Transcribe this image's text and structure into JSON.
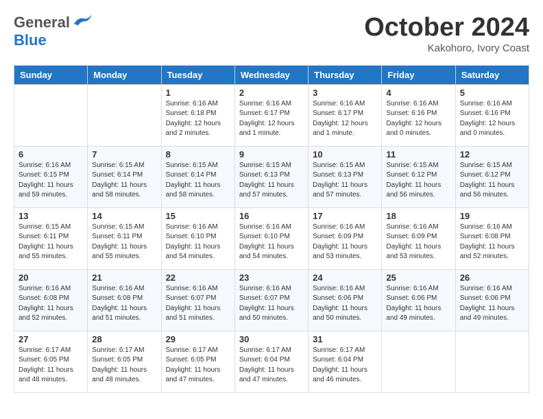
{
  "logo": {
    "general": "General",
    "blue": "Blue"
  },
  "title": "October 2024",
  "subtitle": "Kakohoro, Ivory Coast",
  "days_header": [
    "Sunday",
    "Monday",
    "Tuesday",
    "Wednesday",
    "Thursday",
    "Friday",
    "Saturday"
  ],
  "weeks": [
    [
      {
        "day": "",
        "info": ""
      },
      {
        "day": "",
        "info": ""
      },
      {
        "day": "1",
        "info": "Sunrise: 6:16 AM\nSunset: 6:18 PM\nDaylight: 12 hours\nand 2 minutes."
      },
      {
        "day": "2",
        "info": "Sunrise: 6:16 AM\nSunset: 6:17 PM\nDaylight: 12 hours\nand 1 minute."
      },
      {
        "day": "3",
        "info": "Sunrise: 6:16 AM\nSunset: 6:17 PM\nDaylight: 12 hours\nand 1 minute."
      },
      {
        "day": "4",
        "info": "Sunrise: 6:16 AM\nSunset: 6:16 PM\nDaylight: 12 hours\nand 0 minutes."
      },
      {
        "day": "5",
        "info": "Sunrise: 6:16 AM\nSunset: 6:16 PM\nDaylight: 12 hours\nand 0 minutes."
      }
    ],
    [
      {
        "day": "6",
        "info": "Sunrise: 6:16 AM\nSunset: 6:15 PM\nDaylight: 11 hours\nand 59 minutes."
      },
      {
        "day": "7",
        "info": "Sunrise: 6:15 AM\nSunset: 6:14 PM\nDaylight: 11 hours\nand 58 minutes."
      },
      {
        "day": "8",
        "info": "Sunrise: 6:15 AM\nSunset: 6:14 PM\nDaylight: 11 hours\nand 58 minutes."
      },
      {
        "day": "9",
        "info": "Sunrise: 6:15 AM\nSunset: 6:13 PM\nDaylight: 11 hours\nand 57 minutes."
      },
      {
        "day": "10",
        "info": "Sunrise: 6:15 AM\nSunset: 6:13 PM\nDaylight: 11 hours\nand 57 minutes."
      },
      {
        "day": "11",
        "info": "Sunrise: 6:15 AM\nSunset: 6:12 PM\nDaylight: 11 hours\nand 56 minutes."
      },
      {
        "day": "12",
        "info": "Sunrise: 6:15 AM\nSunset: 6:12 PM\nDaylight: 11 hours\nand 56 minutes."
      }
    ],
    [
      {
        "day": "13",
        "info": "Sunrise: 6:15 AM\nSunset: 6:11 PM\nDaylight: 11 hours\nand 55 minutes."
      },
      {
        "day": "14",
        "info": "Sunrise: 6:15 AM\nSunset: 6:11 PM\nDaylight: 11 hours\nand 55 minutes."
      },
      {
        "day": "15",
        "info": "Sunrise: 6:16 AM\nSunset: 6:10 PM\nDaylight: 11 hours\nand 54 minutes."
      },
      {
        "day": "16",
        "info": "Sunrise: 6:16 AM\nSunset: 6:10 PM\nDaylight: 11 hours\nand 54 minutes."
      },
      {
        "day": "17",
        "info": "Sunrise: 6:16 AM\nSunset: 6:09 PM\nDaylight: 11 hours\nand 53 minutes."
      },
      {
        "day": "18",
        "info": "Sunrise: 6:16 AM\nSunset: 6:09 PM\nDaylight: 11 hours\nand 53 minutes."
      },
      {
        "day": "19",
        "info": "Sunrise: 6:16 AM\nSunset: 6:08 PM\nDaylight: 11 hours\nand 52 minutes."
      }
    ],
    [
      {
        "day": "20",
        "info": "Sunrise: 6:16 AM\nSunset: 6:08 PM\nDaylight: 11 hours\nand 52 minutes."
      },
      {
        "day": "21",
        "info": "Sunrise: 6:16 AM\nSunset: 6:08 PM\nDaylight: 11 hours\nand 51 minutes."
      },
      {
        "day": "22",
        "info": "Sunrise: 6:16 AM\nSunset: 6:07 PM\nDaylight: 11 hours\nand 51 minutes."
      },
      {
        "day": "23",
        "info": "Sunrise: 6:16 AM\nSunset: 6:07 PM\nDaylight: 11 hours\nand 50 minutes."
      },
      {
        "day": "24",
        "info": "Sunrise: 6:16 AM\nSunset: 6:06 PM\nDaylight: 11 hours\nand 50 minutes."
      },
      {
        "day": "25",
        "info": "Sunrise: 6:16 AM\nSunset: 6:06 PM\nDaylight: 11 hours\nand 49 minutes."
      },
      {
        "day": "26",
        "info": "Sunrise: 6:16 AM\nSunset: 6:06 PM\nDaylight: 11 hours\nand 49 minutes."
      }
    ],
    [
      {
        "day": "27",
        "info": "Sunrise: 6:17 AM\nSunset: 6:05 PM\nDaylight: 11 hours\nand 48 minutes."
      },
      {
        "day": "28",
        "info": "Sunrise: 6:17 AM\nSunset: 6:05 PM\nDaylight: 11 hours\nand 48 minutes."
      },
      {
        "day": "29",
        "info": "Sunrise: 6:17 AM\nSunset: 6:05 PM\nDaylight: 11 hours\nand 47 minutes."
      },
      {
        "day": "30",
        "info": "Sunrise: 6:17 AM\nSunset: 6:04 PM\nDaylight: 11 hours\nand 47 minutes."
      },
      {
        "day": "31",
        "info": "Sunrise: 6:17 AM\nSunset: 6:04 PM\nDaylight: 11 hours\nand 46 minutes."
      },
      {
        "day": "",
        "info": ""
      },
      {
        "day": "",
        "info": ""
      }
    ]
  ]
}
